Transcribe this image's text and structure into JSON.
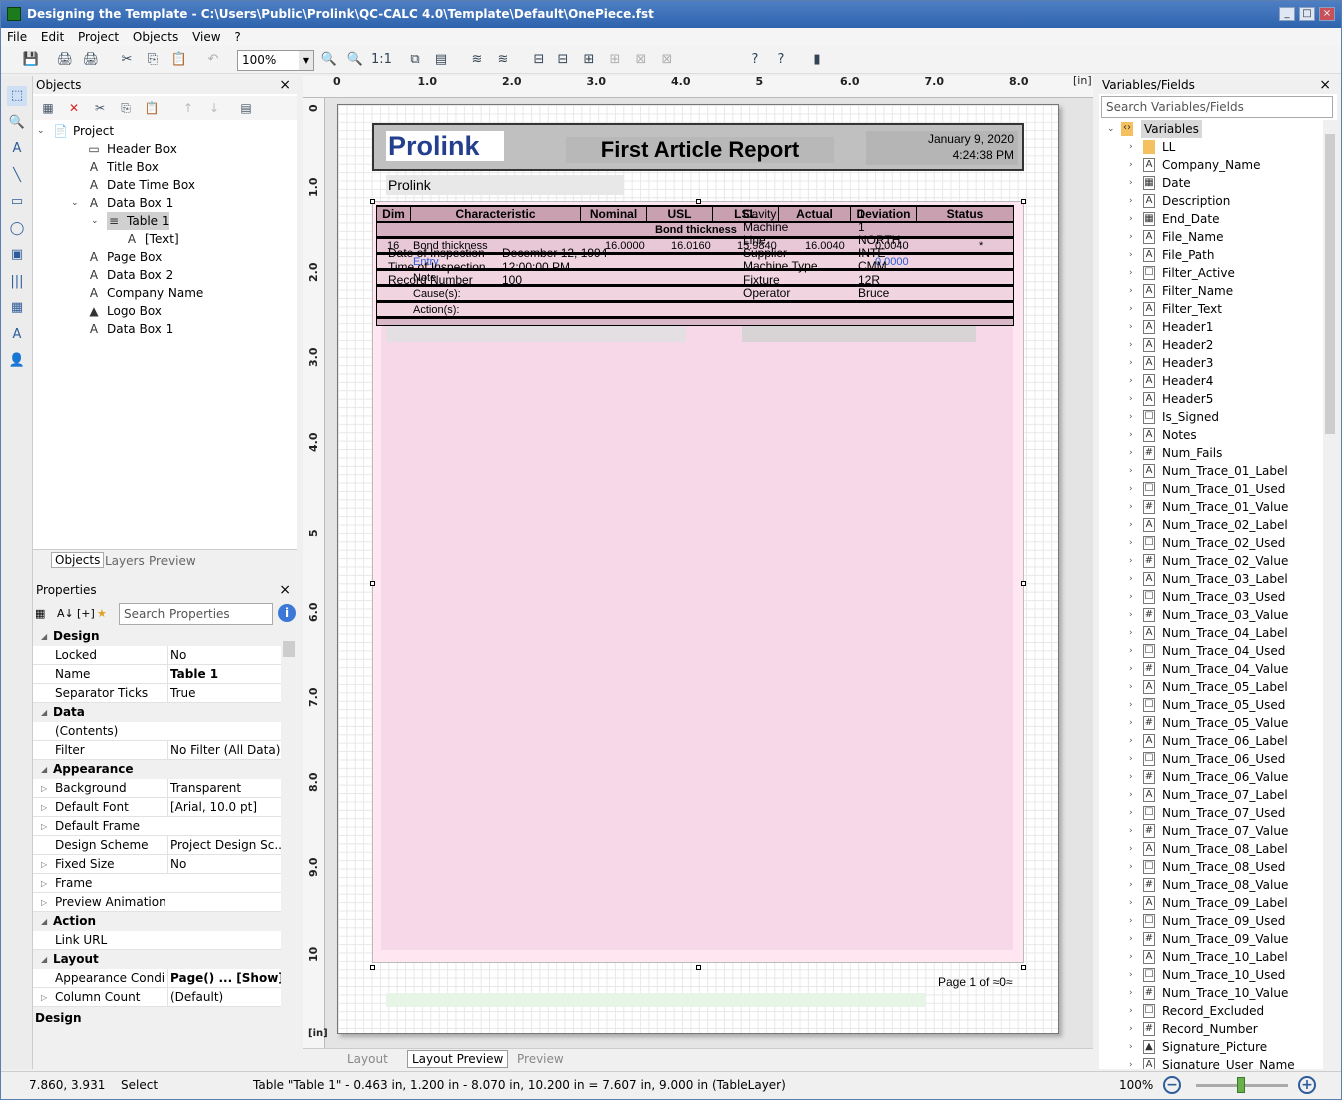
{
  "window": {
    "title": "Designing the Template - C:\\Users\\Public\\Prolink\\QC-CALC 4.0\\Template\\Default\\OnePiece.fst",
    "min_glyph": "_",
    "max_glyph": "□",
    "close_glyph": "×"
  },
  "menu": [
    "File",
    "Edit",
    "Project",
    "Objects",
    "View",
    "?"
  ],
  "toolbar": {
    "zoom_value": "100%",
    "zoom_dropdown": "▼",
    "glyphs": [
      "💾",
      "🖨",
      "🖨",
      "✂",
      "⎘",
      "📋",
      "↶",
      "🔍",
      "🔍",
      "1:1",
      "⧉",
      "▤",
      "≋",
      "≋",
      "⊟",
      "⊟",
      "⊞",
      "⊞",
      "⊠",
      "⊠",
      "?",
      "?",
      "▮"
    ]
  },
  "left_tools": [
    "⬚",
    "🔍",
    "A",
    "╲",
    "▭",
    "◯",
    "▣",
    "|||",
    "▦",
    "A",
    "👤"
  ],
  "objects_panel": {
    "title": "Objects",
    "close": "×",
    "tool_glyphs": [
      "▦",
      "✕",
      "✂",
      "⎘",
      "📋",
      "↑",
      "↓",
      "▤"
    ],
    "tree": [
      {
        "label": "Project",
        "icon": "📄",
        "level": 0,
        "expander": "⌄"
      },
      {
        "label": "Header Box",
        "icon": "▭",
        "level": 1,
        "expander": ""
      },
      {
        "label": "Title Box",
        "icon": "A",
        "level": 1,
        "expander": ""
      },
      {
        "label": "Date Time Box",
        "icon": "A",
        "level": 1,
        "expander": ""
      },
      {
        "label": "Data Box 1",
        "icon": "A",
        "level": 1,
        "expander": "⌄"
      },
      {
        "label": "Table 1",
        "icon": "≡",
        "level": 2,
        "expander": "⌄"
      },
      {
        "label": "[Text]",
        "icon": "A",
        "level": 3,
        "expander": ""
      },
      {
        "label": "Page Box",
        "icon": "A",
        "level": 1,
        "expander": ""
      },
      {
        "label": "Data Box 2",
        "icon": "A",
        "level": 1,
        "expander": ""
      },
      {
        "label": "Company Name",
        "icon": "A",
        "level": 1,
        "expander": ""
      },
      {
        "label": "Logo Box",
        "icon": "▲",
        "level": 1,
        "expander": ""
      },
      {
        "label": "Data Box 1",
        "icon": "A",
        "level": 1,
        "expander": ""
      }
    ],
    "tabs": [
      "Objects",
      "Layers",
      "Preview"
    ]
  },
  "properties_panel": {
    "title": "Properties",
    "close": "×",
    "search_placeholder": "Search Properties",
    "info": "i",
    "tool_glyphs": [
      "▦",
      "A↓",
      "[+]",
      "★",
      "▼"
    ],
    "rows": [
      {
        "cat": true,
        "k": "Design",
        "v": "",
        "ex": "◢"
      },
      {
        "k": "Locked",
        "v": "No",
        "ex": ""
      },
      {
        "k": "Name",
        "v": "Table 1",
        "ex": ""
      },
      {
        "k": "Separator Ticks",
        "v": "True",
        "ex": ""
      },
      {
        "cat": true,
        "k": "Data",
        "v": "",
        "ex": "◢"
      },
      {
        "k": "(Contents)",
        "v": "",
        "ex": ""
      },
      {
        "k": "Filter",
        "v": "No Filter (All Data)",
        "ex": ""
      },
      {
        "cat": true,
        "k": "Appearance",
        "v": "",
        "ex": "◢"
      },
      {
        "k": "Background",
        "v": "Transparent",
        "ex": "▷"
      },
      {
        "k": "Default Font",
        "v": "[Arial, 10.0 pt]",
        "ex": "▷"
      },
      {
        "k": "Default Frame",
        "v": "",
        "ex": "▷"
      },
      {
        "k": "Design Scheme",
        "v": "Project Design Sc...",
        "ex": ""
      },
      {
        "k": "Fixed Size",
        "v": "No",
        "ex": "▷"
      },
      {
        "k": "Frame",
        "v": "",
        "ex": "▷"
      },
      {
        "k": "Preview Animation",
        "v": "",
        "ex": "▷"
      },
      {
        "cat": true,
        "k": "Action",
        "v": "",
        "ex": "◢"
      },
      {
        "k": "Link URL",
        "v": "",
        "ex": ""
      },
      {
        "cat": true,
        "k": "Layout",
        "v": "",
        "ex": "◢"
      },
      {
        "k": "Appearance Condi...",
        "v": "Page() ...  [Show]",
        "ex": ""
      },
      {
        "k": "Column Count",
        "v": "(Default)",
        "ex": "▷"
      }
    ],
    "description_title": "Design"
  },
  "design": {
    "unit": "[in]",
    "h_ruler": [
      "0",
      "1.0",
      "2.0",
      "3.0",
      "4.0",
      "5",
      "6.0",
      "7.0",
      "8.0"
    ],
    "v_ruler": [
      "0",
      "1.0",
      "2.0",
      "3.0",
      "4.0",
      "5",
      "6.0",
      "7.0",
      "8.0",
      "9.0",
      "10"
    ],
    "logo_text": "Prolink",
    "report_title": "First Article Report",
    "date": "January 9, 2020",
    "time": "4:24:38 PM",
    "company": "Prolink",
    "table_headers": [
      "Dim",
      "Characteristic",
      "Nominal",
      "USL",
      "LSL",
      "Actual",
      "Deviation",
      "Status"
    ],
    "group_label": "Bond thickness",
    "row1": [
      "16",
      "Bond thickness",
      "16.0000",
      "16.0160",
      "15.9840",
      "16.0040",
      "0.0040",
      "*"
    ],
    "cause_label": "Cause(s):",
    "action_label": "Action(s):",
    "note_label": "Note",
    "left_info": [
      {
        "k": "Date of Inspection",
        "v": "December 12, 1994"
      },
      {
        "k": "Time of Inspection",
        "v": "12:00:00 PM"
      },
      {
        "k": "Record Number",
        "v": "100"
      }
    ],
    "right_info": [
      {
        "k": "Cavity",
        "v": "1"
      },
      {
        "k": "Machine",
        "v": "1"
      },
      {
        "k": "Line",
        "v": "NORTH"
      },
      {
        "k": "Supplier",
        "v": "INTE"
      },
      {
        "k": "Machine Type",
        "v": "CMM"
      },
      {
        "k": "Fixture",
        "v": "12R"
      },
      {
        "k": "Operator",
        "v": "Bruce"
      }
    ],
    "blue_a": "Entry",
    "blue_b": "0.0000",
    "page_text": "Page  1  of  ≈0≈",
    "tabs": [
      "Layout",
      "Layout Preview",
      "Preview"
    ]
  },
  "variables_panel": {
    "title": "Variables/Fields",
    "close": "×",
    "search_placeholder": "Search Variables/Fields",
    "root": "Variables",
    "items": [
      {
        "n": "LL",
        "t": "folder"
      },
      {
        "n": "Company_Name",
        "t": "A"
      },
      {
        "n": "Date",
        "t": "cal"
      },
      {
        "n": "Description",
        "t": "A"
      },
      {
        "n": "End_Date",
        "t": "cal"
      },
      {
        "n": "File_Name",
        "t": "A"
      },
      {
        "n": "File_Path",
        "t": "A"
      },
      {
        "n": "Filter_Active",
        "t": "bool"
      },
      {
        "n": "Filter_Name",
        "t": "A"
      },
      {
        "n": "Filter_Text",
        "t": "A"
      },
      {
        "n": "Header1",
        "t": "A"
      },
      {
        "n": "Header2",
        "t": "A"
      },
      {
        "n": "Header3",
        "t": "A"
      },
      {
        "n": "Header4",
        "t": "A"
      },
      {
        "n": "Header5",
        "t": "A"
      },
      {
        "n": "Is_Signed",
        "t": "bool"
      },
      {
        "n": "Notes",
        "t": "A"
      },
      {
        "n": "Num_Fails",
        "t": "num"
      },
      {
        "n": "Num_Trace_01_Label",
        "t": "A"
      },
      {
        "n": "Num_Trace_01_Used",
        "t": "bool"
      },
      {
        "n": "Num_Trace_01_Value",
        "t": "num"
      },
      {
        "n": "Num_Trace_02_Label",
        "t": "A"
      },
      {
        "n": "Num_Trace_02_Used",
        "t": "bool"
      },
      {
        "n": "Num_Trace_02_Value",
        "t": "num"
      },
      {
        "n": "Num_Trace_03_Label",
        "t": "A"
      },
      {
        "n": "Num_Trace_03_Used",
        "t": "bool"
      },
      {
        "n": "Num_Trace_03_Value",
        "t": "num"
      },
      {
        "n": "Num_Trace_04_Label",
        "t": "A"
      },
      {
        "n": "Num_Trace_04_Used",
        "t": "bool"
      },
      {
        "n": "Num_Trace_04_Value",
        "t": "num"
      },
      {
        "n": "Num_Trace_05_Label",
        "t": "A"
      },
      {
        "n": "Num_Trace_05_Used",
        "t": "bool"
      },
      {
        "n": "Num_Trace_05_Value",
        "t": "num"
      },
      {
        "n": "Num_Trace_06_Label",
        "t": "A"
      },
      {
        "n": "Num_Trace_06_Used",
        "t": "bool"
      },
      {
        "n": "Num_Trace_06_Value",
        "t": "num"
      },
      {
        "n": "Num_Trace_07_Label",
        "t": "A"
      },
      {
        "n": "Num_Trace_07_Used",
        "t": "bool"
      },
      {
        "n": "Num_Trace_07_Value",
        "t": "num"
      },
      {
        "n": "Num_Trace_08_Label",
        "t": "A"
      },
      {
        "n": "Num_Trace_08_Used",
        "t": "bool"
      },
      {
        "n": "Num_Trace_08_Value",
        "t": "num"
      },
      {
        "n": "Num_Trace_09_Label",
        "t": "A"
      },
      {
        "n": "Num_Trace_09_Used",
        "t": "bool"
      },
      {
        "n": "Num_Trace_09_Value",
        "t": "num"
      },
      {
        "n": "Num_Trace_10_Label",
        "t": "A"
      },
      {
        "n": "Num_Trace_10_Used",
        "t": "bool"
      },
      {
        "n": "Num_Trace_10_Value",
        "t": "num"
      },
      {
        "n": "Record_Excluded",
        "t": "bool"
      },
      {
        "n": "Record_Number",
        "t": "num"
      },
      {
        "n": "Signature_Picture",
        "t": "pic"
      },
      {
        "n": "Signature_User_Name",
        "t": "A"
      }
    ]
  },
  "status": {
    "coords": "7.860, 3.931",
    "mode": "Select",
    "info": "Table \"Table 1\"  -  0.463 in, 1.200 in  -  8.070 in, 10.200 in  =  7.607 in, 9.000 in (TableLayer)",
    "zoom": "100%",
    "zoom_out": "−",
    "zoom_in": "+"
  }
}
